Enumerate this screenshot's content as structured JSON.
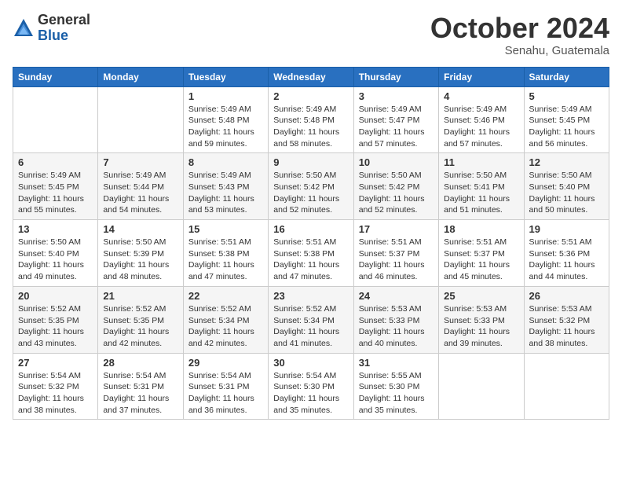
{
  "logo": {
    "general": "General",
    "blue": "Blue"
  },
  "title": "October 2024",
  "location": "Senahu, Guatemala",
  "days_header": [
    "Sunday",
    "Monday",
    "Tuesday",
    "Wednesday",
    "Thursday",
    "Friday",
    "Saturday"
  ],
  "weeks": [
    [
      {
        "day": "",
        "content": ""
      },
      {
        "day": "",
        "content": ""
      },
      {
        "day": "1",
        "content": "Sunrise: 5:49 AM\nSunset: 5:48 PM\nDaylight: 11 hours and 59 minutes."
      },
      {
        "day": "2",
        "content": "Sunrise: 5:49 AM\nSunset: 5:48 PM\nDaylight: 11 hours and 58 minutes."
      },
      {
        "day": "3",
        "content": "Sunrise: 5:49 AM\nSunset: 5:47 PM\nDaylight: 11 hours and 57 minutes."
      },
      {
        "day": "4",
        "content": "Sunrise: 5:49 AM\nSunset: 5:46 PM\nDaylight: 11 hours and 57 minutes."
      },
      {
        "day": "5",
        "content": "Sunrise: 5:49 AM\nSunset: 5:45 PM\nDaylight: 11 hours and 56 minutes."
      }
    ],
    [
      {
        "day": "6",
        "content": "Sunrise: 5:49 AM\nSunset: 5:45 PM\nDaylight: 11 hours and 55 minutes."
      },
      {
        "day": "7",
        "content": "Sunrise: 5:49 AM\nSunset: 5:44 PM\nDaylight: 11 hours and 54 minutes."
      },
      {
        "day": "8",
        "content": "Sunrise: 5:49 AM\nSunset: 5:43 PM\nDaylight: 11 hours and 53 minutes."
      },
      {
        "day": "9",
        "content": "Sunrise: 5:50 AM\nSunset: 5:42 PM\nDaylight: 11 hours and 52 minutes."
      },
      {
        "day": "10",
        "content": "Sunrise: 5:50 AM\nSunset: 5:42 PM\nDaylight: 11 hours and 52 minutes."
      },
      {
        "day": "11",
        "content": "Sunrise: 5:50 AM\nSunset: 5:41 PM\nDaylight: 11 hours and 51 minutes."
      },
      {
        "day": "12",
        "content": "Sunrise: 5:50 AM\nSunset: 5:40 PM\nDaylight: 11 hours and 50 minutes."
      }
    ],
    [
      {
        "day": "13",
        "content": "Sunrise: 5:50 AM\nSunset: 5:40 PM\nDaylight: 11 hours and 49 minutes."
      },
      {
        "day": "14",
        "content": "Sunrise: 5:50 AM\nSunset: 5:39 PM\nDaylight: 11 hours and 48 minutes."
      },
      {
        "day": "15",
        "content": "Sunrise: 5:51 AM\nSunset: 5:38 PM\nDaylight: 11 hours and 47 minutes."
      },
      {
        "day": "16",
        "content": "Sunrise: 5:51 AM\nSunset: 5:38 PM\nDaylight: 11 hours and 47 minutes."
      },
      {
        "day": "17",
        "content": "Sunrise: 5:51 AM\nSunset: 5:37 PM\nDaylight: 11 hours and 46 minutes."
      },
      {
        "day": "18",
        "content": "Sunrise: 5:51 AM\nSunset: 5:37 PM\nDaylight: 11 hours and 45 minutes."
      },
      {
        "day": "19",
        "content": "Sunrise: 5:51 AM\nSunset: 5:36 PM\nDaylight: 11 hours and 44 minutes."
      }
    ],
    [
      {
        "day": "20",
        "content": "Sunrise: 5:52 AM\nSunset: 5:35 PM\nDaylight: 11 hours and 43 minutes."
      },
      {
        "day": "21",
        "content": "Sunrise: 5:52 AM\nSunset: 5:35 PM\nDaylight: 11 hours and 42 minutes."
      },
      {
        "day": "22",
        "content": "Sunrise: 5:52 AM\nSunset: 5:34 PM\nDaylight: 11 hours and 42 minutes."
      },
      {
        "day": "23",
        "content": "Sunrise: 5:52 AM\nSunset: 5:34 PM\nDaylight: 11 hours and 41 minutes."
      },
      {
        "day": "24",
        "content": "Sunrise: 5:53 AM\nSunset: 5:33 PM\nDaylight: 11 hours and 40 minutes."
      },
      {
        "day": "25",
        "content": "Sunrise: 5:53 AM\nSunset: 5:33 PM\nDaylight: 11 hours and 39 minutes."
      },
      {
        "day": "26",
        "content": "Sunrise: 5:53 AM\nSunset: 5:32 PM\nDaylight: 11 hours and 38 minutes."
      }
    ],
    [
      {
        "day": "27",
        "content": "Sunrise: 5:54 AM\nSunset: 5:32 PM\nDaylight: 11 hours and 38 minutes."
      },
      {
        "day": "28",
        "content": "Sunrise: 5:54 AM\nSunset: 5:31 PM\nDaylight: 11 hours and 37 minutes."
      },
      {
        "day": "29",
        "content": "Sunrise: 5:54 AM\nSunset: 5:31 PM\nDaylight: 11 hours and 36 minutes."
      },
      {
        "day": "30",
        "content": "Sunrise: 5:54 AM\nSunset: 5:30 PM\nDaylight: 11 hours and 35 minutes."
      },
      {
        "day": "31",
        "content": "Sunrise: 5:55 AM\nSunset: 5:30 PM\nDaylight: 11 hours and 35 minutes."
      },
      {
        "day": "",
        "content": ""
      },
      {
        "day": "",
        "content": ""
      }
    ]
  ]
}
